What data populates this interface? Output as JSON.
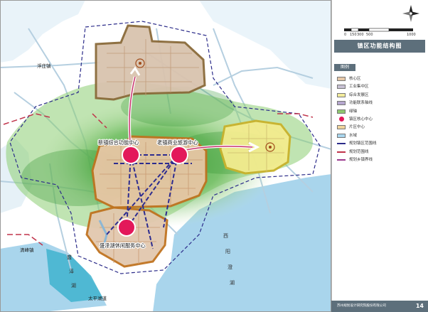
{
  "map": {
    "places": {
      "pu_zhuang": "浮庄镇",
      "qingfeng": "清峰镇",
      "taiping": "太平湖道",
      "shenghu_lake": [
        "盛",
        "泽",
        "湖"
      ],
      "xiyang_lake": [
        "西",
        "阳",
        "澄",
        "湖"
      ]
    },
    "centers": {
      "new_town": "新镇综合功能中心",
      "old_town": "老镇商业旅游中心",
      "lakeside": "盛泽湖休闲服务中心"
    }
  },
  "panel": {
    "scale_labels": [
      "0",
      "150",
      "300",
      "500",
      "1000"
    ],
    "title": "镇区功能结构图",
    "legend_title": "图例",
    "legend": [
      {
        "label": "核心区",
        "kind": "fill",
        "color": "#e7c9a9"
      },
      {
        "label": "工业集中区",
        "kind": "fill",
        "color": "#c8c1d4"
      },
      {
        "label": "综合发展区",
        "kind": "fill",
        "color": "#f3ec9c"
      },
      {
        "label": "功能联系轴线",
        "kind": "fill",
        "color": "#b6a7cf"
      },
      {
        "label": "绿轴",
        "kind": "fill",
        "color": "#8fc86f"
      },
      {
        "label": "镇区核心中心",
        "kind": "dot",
        "color": "#e3185a"
      },
      {
        "label": "片区中心",
        "kind": "fill",
        "color": "#f1d59d"
      },
      {
        "label": "水域",
        "kind": "fill",
        "color": "#a9d6ee"
      },
      {
        "label": "规划镇区范围线",
        "kind": "line",
        "color": "#2c2c8a"
      },
      {
        "label": "规划范围线",
        "kind": "solid",
        "color": "#c0334a"
      },
      {
        "label": "规划乡镇界线",
        "kind": "line",
        "color": "#9b3a8f"
      }
    ],
    "footer_org": "苏州规划设计研究院股份有限公司",
    "page": "14"
  }
}
